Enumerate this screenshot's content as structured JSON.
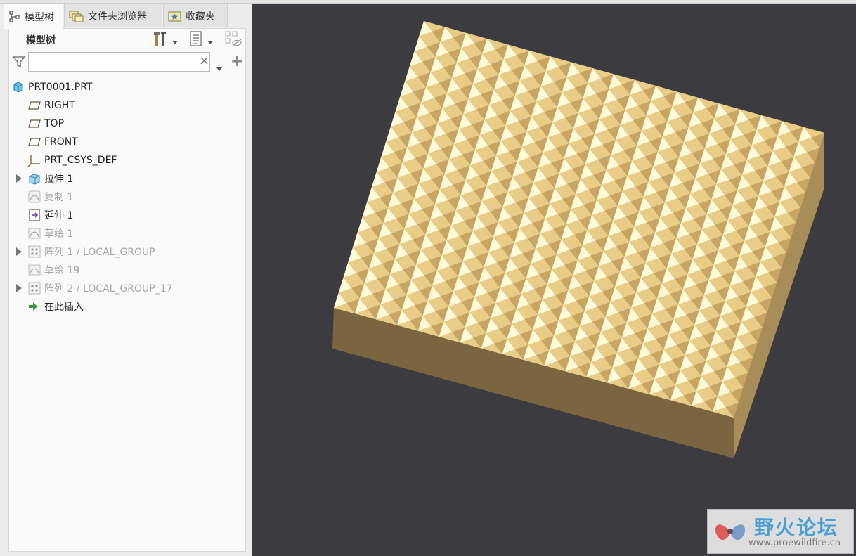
{
  "tabs": [
    {
      "label": "模型树",
      "icon": "model-tree-icon",
      "active": true
    },
    {
      "label": "文件夹浏览器",
      "icon": "folder-browser-icon",
      "active": false
    },
    {
      "label": "收藏夹",
      "icon": "favorites-icon",
      "active": false
    }
  ],
  "panel": {
    "title": "模型树",
    "filter_placeholder": "",
    "clear_symbol": "×",
    "add_symbol": "+"
  },
  "tree": [
    {
      "label": "PRT0001.PRT",
      "icon": "part-icon",
      "expandable": false,
      "dim": false,
      "indent": 0
    },
    {
      "label": "RIGHT",
      "icon": "datum-plane-icon",
      "expandable": false,
      "dim": false,
      "indent": 1
    },
    {
      "label": "TOP",
      "icon": "datum-plane-icon",
      "expandable": false,
      "dim": false,
      "indent": 1
    },
    {
      "label": "FRONT",
      "icon": "datum-plane-icon",
      "expandable": false,
      "dim": false,
      "indent": 1
    },
    {
      "label": "PRT_CSYS_DEF",
      "icon": "coordinate-system-icon",
      "expandable": false,
      "dim": false,
      "indent": 1
    },
    {
      "label": "拉伸 1",
      "icon": "extrude-icon",
      "expandable": true,
      "dim": false,
      "indent": 1
    },
    {
      "label": "复制 1",
      "icon": "copy-icon",
      "expandable": false,
      "dim": true,
      "indent": 1
    },
    {
      "label": "延伸 1",
      "icon": "extend-icon",
      "expandable": false,
      "dim": false,
      "indent": 1
    },
    {
      "label": "草绘 1",
      "icon": "sketch-icon",
      "expandable": false,
      "dim": true,
      "indent": 1
    },
    {
      "label": "阵列 1 / LOCAL_GROUP",
      "icon": "pattern-icon",
      "expandable": true,
      "dim": true,
      "indent": 1
    },
    {
      "label": "草绘 19",
      "icon": "sketch-icon",
      "expandable": false,
      "dim": true,
      "indent": 1
    },
    {
      "label": "阵列 2 / LOCAL_GROUP_17",
      "icon": "pattern-icon",
      "expandable": true,
      "dim": true,
      "indent": 1
    },
    {
      "label": "在此插入",
      "icon": "insert-here-arrow-icon",
      "expandable": false,
      "dim": false,
      "indent": 1
    }
  ],
  "watermark": {
    "title": "野火论坛",
    "url": "www.proewildfire.cn"
  },
  "colors": {
    "viewport_bg": "#3c3b40",
    "model_top_light": "#fffbd9",
    "model_top_mid": "#e8cc87",
    "model_top_dark": "#c9a564",
    "model_side_front": "#7a6540",
    "model_side_right": "#a88d58"
  }
}
